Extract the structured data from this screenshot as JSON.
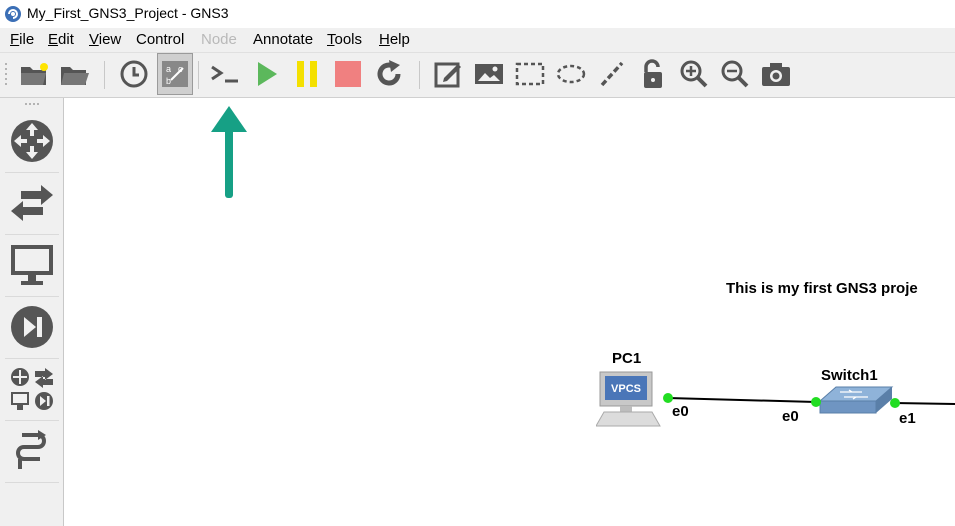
{
  "window": {
    "title": "My_First_GNS3_Project - GNS3"
  },
  "menu": {
    "file": {
      "u": "F",
      "rest": "ile"
    },
    "edit": {
      "u": "E",
      "rest": "dit"
    },
    "view": {
      "u": "V",
      "rest": "iew"
    },
    "control": "Control",
    "node": "Node",
    "annotate": "Annotate",
    "tools": {
      "u": "T",
      "rest": "ools"
    },
    "help": {
      "u": "H",
      "rest": "elp"
    }
  },
  "toolbar_icons": [
    "new-project-icon",
    "open-project-icon",
    "snapshot-icon",
    "show-interface-labels-icon",
    "console-all-icon",
    "start-all-icon",
    "suspend-all-icon",
    "stop-all-icon",
    "reload-all-icon",
    "add-note-icon",
    "insert-picture-icon",
    "draw-rectangle-icon",
    "draw-ellipse-icon",
    "draw-line-icon",
    "lock-icon",
    "zoom-in-icon",
    "zoom-out-icon",
    "screenshot-icon"
  ],
  "sidebar_icons": [
    "routers-icon",
    "switches-icon",
    "end-devices-icon",
    "security-devices-icon",
    "all-devices-icon",
    "add-link-icon"
  ],
  "colors": {
    "accent_arrow": "#16a085",
    "start": "#5cb85c",
    "suspend": "#f4e000",
    "stop": "#f08080",
    "port_up": "#22dd22"
  },
  "canvas": {
    "note": "This is my first GNS3 proje",
    "nodes": {
      "pc1": {
        "label": "PC1",
        "icon_text": "VPCS"
      },
      "switch1": {
        "label": "Switch1"
      }
    },
    "ports": {
      "pc1_e0": "e0",
      "switch1_e0": "e0",
      "switch1_e1": "e1"
    }
  }
}
